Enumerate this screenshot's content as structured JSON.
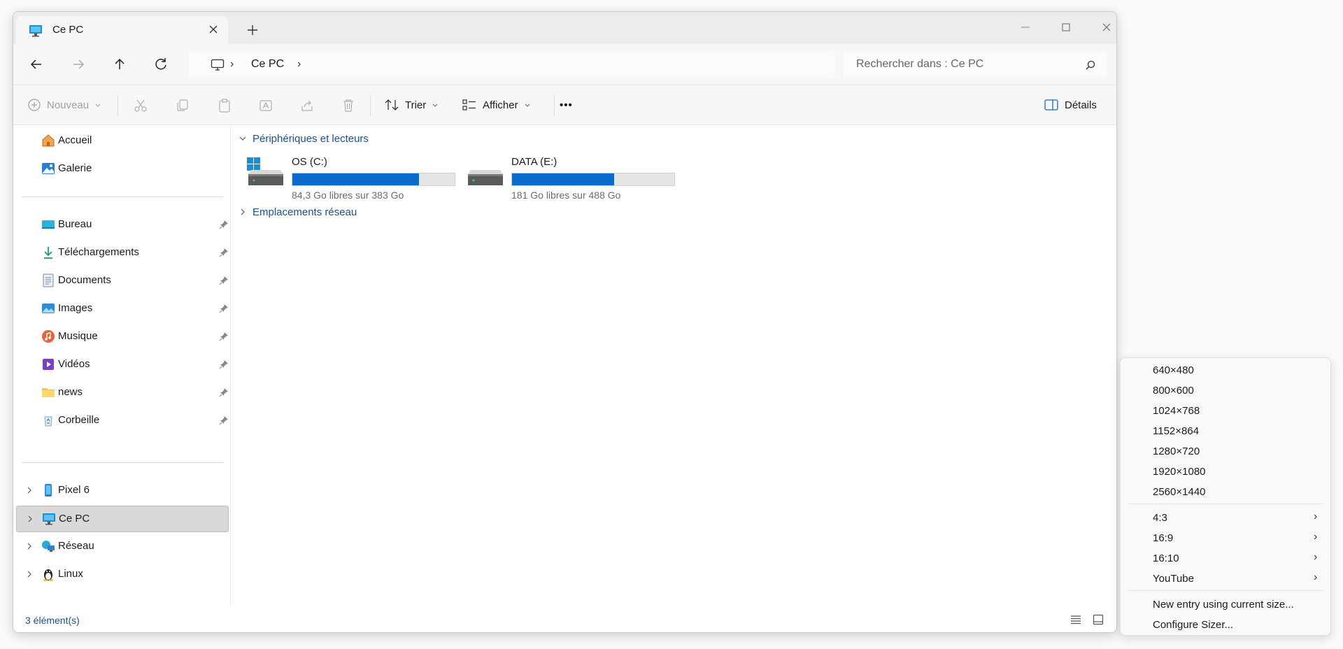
{
  "window": {
    "tab_title": "Ce PC",
    "address": {
      "location": "Ce PC",
      "separator": "›"
    },
    "search": {
      "placeholder": "Rechercher dans : Ce PC"
    }
  },
  "toolbar": {
    "new_label": "Nouveau",
    "sort_label": "Trier",
    "view_label": "Afficher",
    "more_label": "•••",
    "details_label": "Détails"
  },
  "sidebar": {
    "quick": [
      {
        "label": "Accueil",
        "icon": "home-icon"
      },
      {
        "label": "Galerie",
        "icon": "gallery-icon"
      }
    ],
    "pinned": [
      {
        "label": "Bureau",
        "icon": "desktop-folder-icon"
      },
      {
        "label": "Téléchargements",
        "icon": "download-icon"
      },
      {
        "label": "Documents",
        "icon": "documents-icon"
      },
      {
        "label": "Images",
        "icon": "images-icon"
      },
      {
        "label": "Musique",
        "icon": "music-icon"
      },
      {
        "label": "Vidéos",
        "icon": "videos-icon"
      },
      {
        "label": "news",
        "icon": "folder-icon"
      },
      {
        "label": "Corbeille",
        "icon": "recycle-bin-icon"
      }
    ],
    "devices": [
      {
        "label": "Pixel 6",
        "icon": "phone-icon"
      },
      {
        "label": "Ce PC",
        "icon": "pc-icon",
        "selected": true
      },
      {
        "label": "Réseau",
        "icon": "network-icon"
      },
      {
        "label": "Linux",
        "icon": "linux-icon"
      }
    ]
  },
  "content": {
    "group_devices": "Périphériques et lecteurs",
    "group_network": "Emplacements réseau",
    "drives": [
      {
        "name": "OS (C:)",
        "free_text": "84,3 Go libres sur 383 Go",
        "used_fraction": 0.78
      },
      {
        "name": "DATA (E:)",
        "free_text": "181 Go libres sur 488 Go",
        "used_fraction": 0.63
      }
    ]
  },
  "status": {
    "items_text": "3 élément(s)"
  },
  "context_menu": {
    "sizes": [
      "640×480",
      "800×600",
      "1024×768",
      "1152×864",
      "1280×720",
      "1920×1080",
      "2560×1440"
    ],
    "submenus": [
      "4:3",
      "16:9",
      "16:10",
      "YouTube"
    ],
    "submenu_arrow": "›",
    "actions": [
      "New entry using current size...",
      "Configure Sizer..."
    ]
  },
  "colors": {
    "accent": "#0a6bcd",
    "link": "#1d4f91",
    "selected_bg": "#d9d9d9"
  }
}
